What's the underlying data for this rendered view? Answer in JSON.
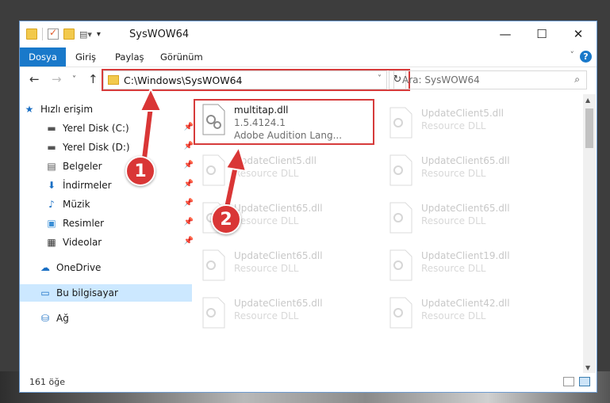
{
  "window": {
    "title": "SysWOW64",
    "controls": {
      "minimize": "—",
      "maximize": "☐",
      "close": "✕"
    }
  },
  "ribbon": {
    "tabs": [
      "Dosya",
      "Giriş",
      "Paylaş",
      "Görünüm"
    ],
    "active_tab": "Dosya",
    "help": "?"
  },
  "address": {
    "path": "C:\\Windows\\SysWOW64",
    "search_placeholder": "Ara: SysWOW64"
  },
  "sidebar": {
    "items": [
      {
        "label": "Hızlı erişim",
        "icon": "star-icon",
        "pinned": false
      },
      {
        "label": "Yerel Disk (C:)",
        "icon": "drive-icon",
        "pinned": true
      },
      {
        "label": "Yerel Disk (D:)",
        "icon": "drive-icon",
        "pinned": true
      },
      {
        "label": "Belgeler",
        "icon": "documents-icon",
        "pinned": true
      },
      {
        "label": "İndirmeler",
        "icon": "download-icon",
        "pinned": true
      },
      {
        "label": "Müzik",
        "icon": "music-icon",
        "pinned": true
      },
      {
        "label": "Resimler",
        "icon": "pictures-icon",
        "pinned": true
      },
      {
        "label": "Videolar",
        "icon": "video-icon",
        "pinned": true
      },
      {
        "label": "OneDrive",
        "icon": "cloud-icon",
        "pinned": false
      },
      {
        "label": "Bu bilgisayar",
        "icon": "computer-icon",
        "pinned": false
      },
      {
        "label": "Ağ",
        "icon": "network-icon",
        "pinned": false
      }
    ]
  },
  "files": {
    "left": [
      {
        "name": "multitap.dll",
        "line2": "1.5.4124.1",
        "line3": "Adobe Audition Lang...",
        "selected": true
      },
      {
        "name": "UpdateClient5.dll",
        "line2": "Resource DLL",
        "selected": false
      },
      {
        "name": "UpdateClient65.dll",
        "line2": "Resource DLL",
        "selected": false
      },
      {
        "name": "UpdateClient65.dll",
        "line2": "Resource DLL",
        "selected": false
      },
      {
        "name": "UpdateClient65.dll",
        "line2": "Resource DLL",
        "selected": false
      }
    ],
    "right": [
      {
        "name": "UpdateClient5.dll",
        "line2": "Resource DLL"
      },
      {
        "name": "UpdateClient65.dll",
        "line2": "Resource DLL"
      },
      {
        "name": "UpdateClient65.dll",
        "line2": "Resource DLL"
      },
      {
        "name": "UpdateClient19.dll",
        "line2": "Resource DLL"
      },
      {
        "name": "UpdateClient42.dll",
        "line2": "Resource DLL"
      }
    ]
  },
  "status": {
    "count": "161 öğe"
  },
  "annotations": {
    "badge1": "1",
    "badge2": "2",
    "color": "#d93636"
  }
}
